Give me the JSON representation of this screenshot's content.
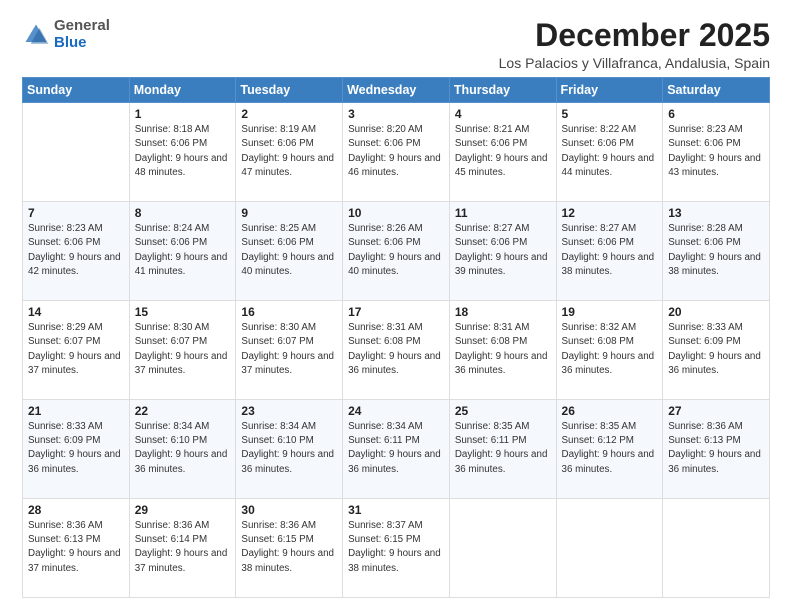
{
  "logo": {
    "general": "General",
    "blue": "Blue"
  },
  "header": {
    "month": "December 2025",
    "location": "Los Palacios y Villafranca, Andalusia, Spain"
  },
  "weekdays": [
    "Sunday",
    "Monday",
    "Tuesday",
    "Wednesday",
    "Thursday",
    "Friday",
    "Saturday"
  ],
  "weeks": [
    [
      {
        "day": "",
        "info": ""
      },
      {
        "day": "1",
        "info": "Sunrise: 8:18 AM\nSunset: 6:06 PM\nDaylight: 9 hours\nand 48 minutes."
      },
      {
        "day": "2",
        "info": "Sunrise: 8:19 AM\nSunset: 6:06 PM\nDaylight: 9 hours\nand 47 minutes."
      },
      {
        "day": "3",
        "info": "Sunrise: 8:20 AM\nSunset: 6:06 PM\nDaylight: 9 hours\nand 46 minutes."
      },
      {
        "day": "4",
        "info": "Sunrise: 8:21 AM\nSunset: 6:06 PM\nDaylight: 9 hours\nand 45 minutes."
      },
      {
        "day": "5",
        "info": "Sunrise: 8:22 AM\nSunset: 6:06 PM\nDaylight: 9 hours\nand 44 minutes."
      },
      {
        "day": "6",
        "info": "Sunrise: 8:23 AM\nSunset: 6:06 PM\nDaylight: 9 hours\nand 43 minutes."
      }
    ],
    [
      {
        "day": "7",
        "info": "Sunrise: 8:23 AM\nSunset: 6:06 PM\nDaylight: 9 hours\nand 42 minutes."
      },
      {
        "day": "8",
        "info": "Sunrise: 8:24 AM\nSunset: 6:06 PM\nDaylight: 9 hours\nand 41 minutes."
      },
      {
        "day": "9",
        "info": "Sunrise: 8:25 AM\nSunset: 6:06 PM\nDaylight: 9 hours\nand 40 minutes."
      },
      {
        "day": "10",
        "info": "Sunrise: 8:26 AM\nSunset: 6:06 PM\nDaylight: 9 hours\nand 40 minutes."
      },
      {
        "day": "11",
        "info": "Sunrise: 8:27 AM\nSunset: 6:06 PM\nDaylight: 9 hours\nand 39 minutes."
      },
      {
        "day": "12",
        "info": "Sunrise: 8:27 AM\nSunset: 6:06 PM\nDaylight: 9 hours\nand 38 minutes."
      },
      {
        "day": "13",
        "info": "Sunrise: 8:28 AM\nSunset: 6:06 PM\nDaylight: 9 hours\nand 38 minutes."
      }
    ],
    [
      {
        "day": "14",
        "info": "Sunrise: 8:29 AM\nSunset: 6:07 PM\nDaylight: 9 hours\nand 37 minutes."
      },
      {
        "day": "15",
        "info": "Sunrise: 8:30 AM\nSunset: 6:07 PM\nDaylight: 9 hours\nand 37 minutes."
      },
      {
        "day": "16",
        "info": "Sunrise: 8:30 AM\nSunset: 6:07 PM\nDaylight: 9 hours\nand 37 minutes."
      },
      {
        "day": "17",
        "info": "Sunrise: 8:31 AM\nSunset: 6:08 PM\nDaylight: 9 hours\nand 36 minutes."
      },
      {
        "day": "18",
        "info": "Sunrise: 8:31 AM\nSunset: 6:08 PM\nDaylight: 9 hours\nand 36 minutes."
      },
      {
        "day": "19",
        "info": "Sunrise: 8:32 AM\nSunset: 6:08 PM\nDaylight: 9 hours\nand 36 minutes."
      },
      {
        "day": "20",
        "info": "Sunrise: 8:33 AM\nSunset: 6:09 PM\nDaylight: 9 hours\nand 36 minutes."
      }
    ],
    [
      {
        "day": "21",
        "info": "Sunrise: 8:33 AM\nSunset: 6:09 PM\nDaylight: 9 hours\nand 36 minutes."
      },
      {
        "day": "22",
        "info": "Sunrise: 8:34 AM\nSunset: 6:10 PM\nDaylight: 9 hours\nand 36 minutes."
      },
      {
        "day": "23",
        "info": "Sunrise: 8:34 AM\nSunset: 6:10 PM\nDaylight: 9 hours\nand 36 minutes."
      },
      {
        "day": "24",
        "info": "Sunrise: 8:34 AM\nSunset: 6:11 PM\nDaylight: 9 hours\nand 36 minutes."
      },
      {
        "day": "25",
        "info": "Sunrise: 8:35 AM\nSunset: 6:11 PM\nDaylight: 9 hours\nand 36 minutes."
      },
      {
        "day": "26",
        "info": "Sunrise: 8:35 AM\nSunset: 6:12 PM\nDaylight: 9 hours\nand 36 minutes."
      },
      {
        "day": "27",
        "info": "Sunrise: 8:36 AM\nSunset: 6:13 PM\nDaylight: 9 hours\nand 36 minutes."
      }
    ],
    [
      {
        "day": "28",
        "info": "Sunrise: 8:36 AM\nSunset: 6:13 PM\nDaylight: 9 hours\nand 37 minutes."
      },
      {
        "day": "29",
        "info": "Sunrise: 8:36 AM\nSunset: 6:14 PM\nDaylight: 9 hours\nand 37 minutes."
      },
      {
        "day": "30",
        "info": "Sunrise: 8:36 AM\nSunset: 6:15 PM\nDaylight: 9 hours\nand 38 minutes."
      },
      {
        "day": "31",
        "info": "Sunrise: 8:37 AM\nSunset: 6:15 PM\nDaylight: 9 hours\nand 38 minutes."
      },
      {
        "day": "",
        "info": ""
      },
      {
        "day": "",
        "info": ""
      },
      {
        "day": "",
        "info": ""
      }
    ]
  ]
}
